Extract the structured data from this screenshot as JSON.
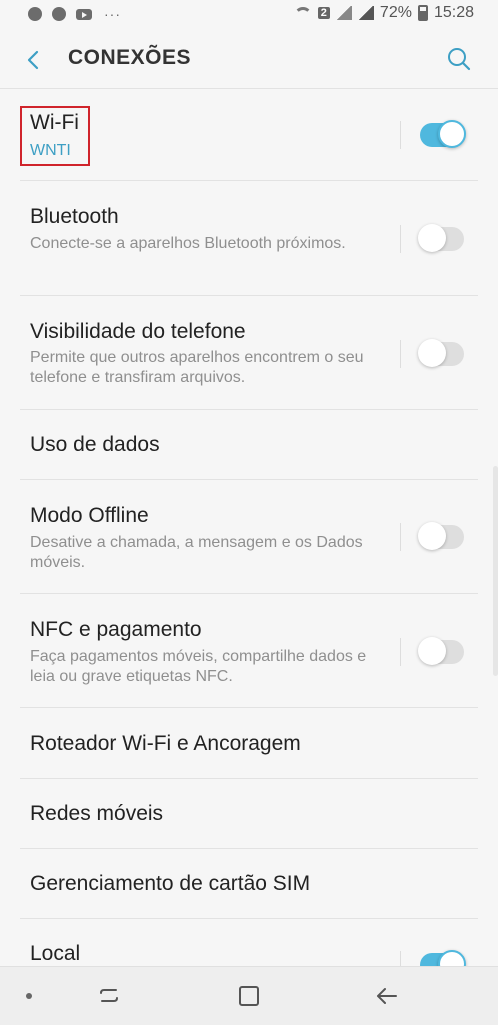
{
  "status_bar": {
    "icons_left": [
      "chrome-icon",
      "chrome-icon",
      "youtube-icon"
    ],
    "more": "···",
    "wifi_badge": "2",
    "battery": "72%",
    "time": "15:28"
  },
  "header": {
    "title": "CONEXÕES"
  },
  "items": [
    {
      "title": "Wi-Fi",
      "subtitle": "WNTI",
      "toggle": true
    },
    {
      "title": "Bluetooth",
      "subtitle": "Conecte-se a aparelhos Bluetooth próximos.",
      "toggle": false
    },
    {
      "title": "Visibilidade do telefone",
      "subtitle": "Permite que outros aparelhos encontrem o seu telefone e transfiram arquivos.",
      "toggle": false
    },
    {
      "title": "Uso de dados"
    },
    {
      "title": "Modo Offline",
      "subtitle": "Desative a chamada, a mensagem e os Dados móveis.",
      "toggle": false
    },
    {
      "title": "NFC e pagamento",
      "subtitle": "Faça pagamentos móveis, compartilhe dados e leia ou grave etiquetas NFC.",
      "toggle": false
    },
    {
      "title": "Roteador Wi-Fi e Ancoragem"
    },
    {
      "title": "Redes móveis"
    },
    {
      "title": "Gerenciamento de cartão SIM"
    },
    {
      "title": "Local",
      "toggle": true
    }
  ],
  "colors": {
    "accent": "#4fb8de",
    "highlight_box": "#d0242b"
  }
}
